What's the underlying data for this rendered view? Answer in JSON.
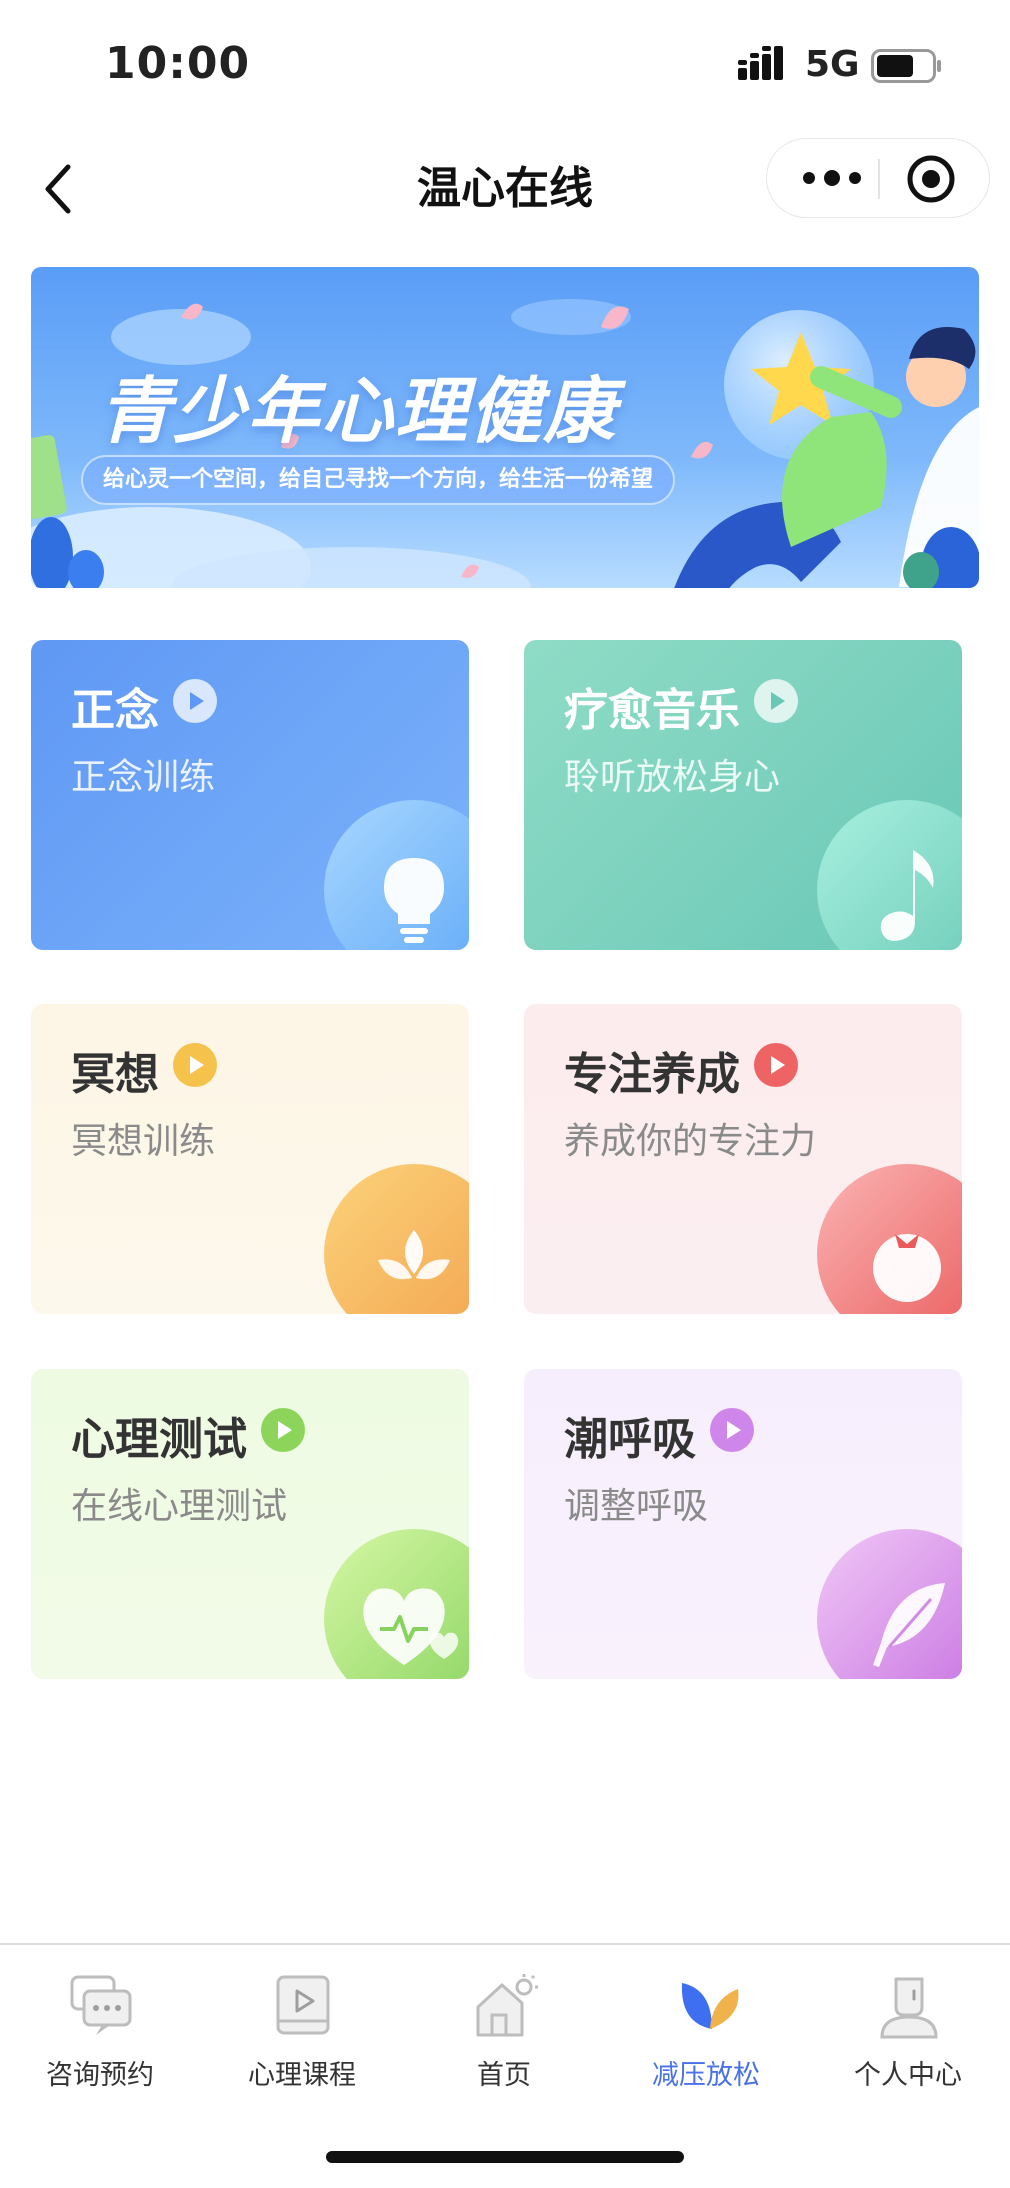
{
  "status_bar": {
    "time": "10:00",
    "network": "5G"
  },
  "navbar": {
    "title": "温心在线"
  },
  "banner": {
    "title": "青少年心理健康",
    "subtitle": "给心灵一个空间，给自己寻找一个方向，给生活一份希望"
  },
  "cards": [
    {
      "title": "正念",
      "subtitle": "正念训练",
      "icon": "lightbulb-icon",
      "title_color": "#ffffff",
      "sub_color": "#eaf1ff",
      "accent": "#8ab3ff"
    },
    {
      "title": "疗愈音乐",
      "subtitle": "聆听放松身心",
      "icon": "music-note-icon",
      "title_color": "#ffffff",
      "sub_color": "#eafaf5",
      "accent": "#8fe0cb"
    },
    {
      "title": "冥想",
      "subtitle": "冥想训练",
      "icon": "lotus-icon",
      "title_color": "#333333",
      "sub_color": "#8a8a8a",
      "accent": "#f5b94a"
    },
    {
      "title": "专注养成",
      "subtitle": "养成你的专注力",
      "icon": "tomato-icon",
      "title_color": "#333333",
      "sub_color": "#8a8a8a",
      "accent": "#ee6a6a"
    },
    {
      "title": "心理测试",
      "subtitle": "在线心理测试",
      "icon": "heart-pulse-icon",
      "title_color": "#333333",
      "sub_color": "#8a8a8a",
      "accent": "#8fd65a"
    },
    {
      "title": "潮呼吸",
      "subtitle": "调整呼吸",
      "icon": "feather-icon",
      "title_color": "#333333",
      "sub_color": "#8a8a8a",
      "accent": "#d48ae8"
    }
  ],
  "tabbar": {
    "items": [
      {
        "label": "咨询预约",
        "icon": "chat-bubbles-icon",
        "active": false
      },
      {
        "label": "心理课程",
        "icon": "video-course-icon",
        "active": false
      },
      {
        "label": "首页",
        "icon": "home-icon",
        "active": false
      },
      {
        "label": "减压放松",
        "icon": "leaves-icon",
        "active": true
      },
      {
        "label": "个人中心",
        "icon": "user-icon",
        "active": false
      }
    ],
    "active_color": "#4a72e8"
  }
}
